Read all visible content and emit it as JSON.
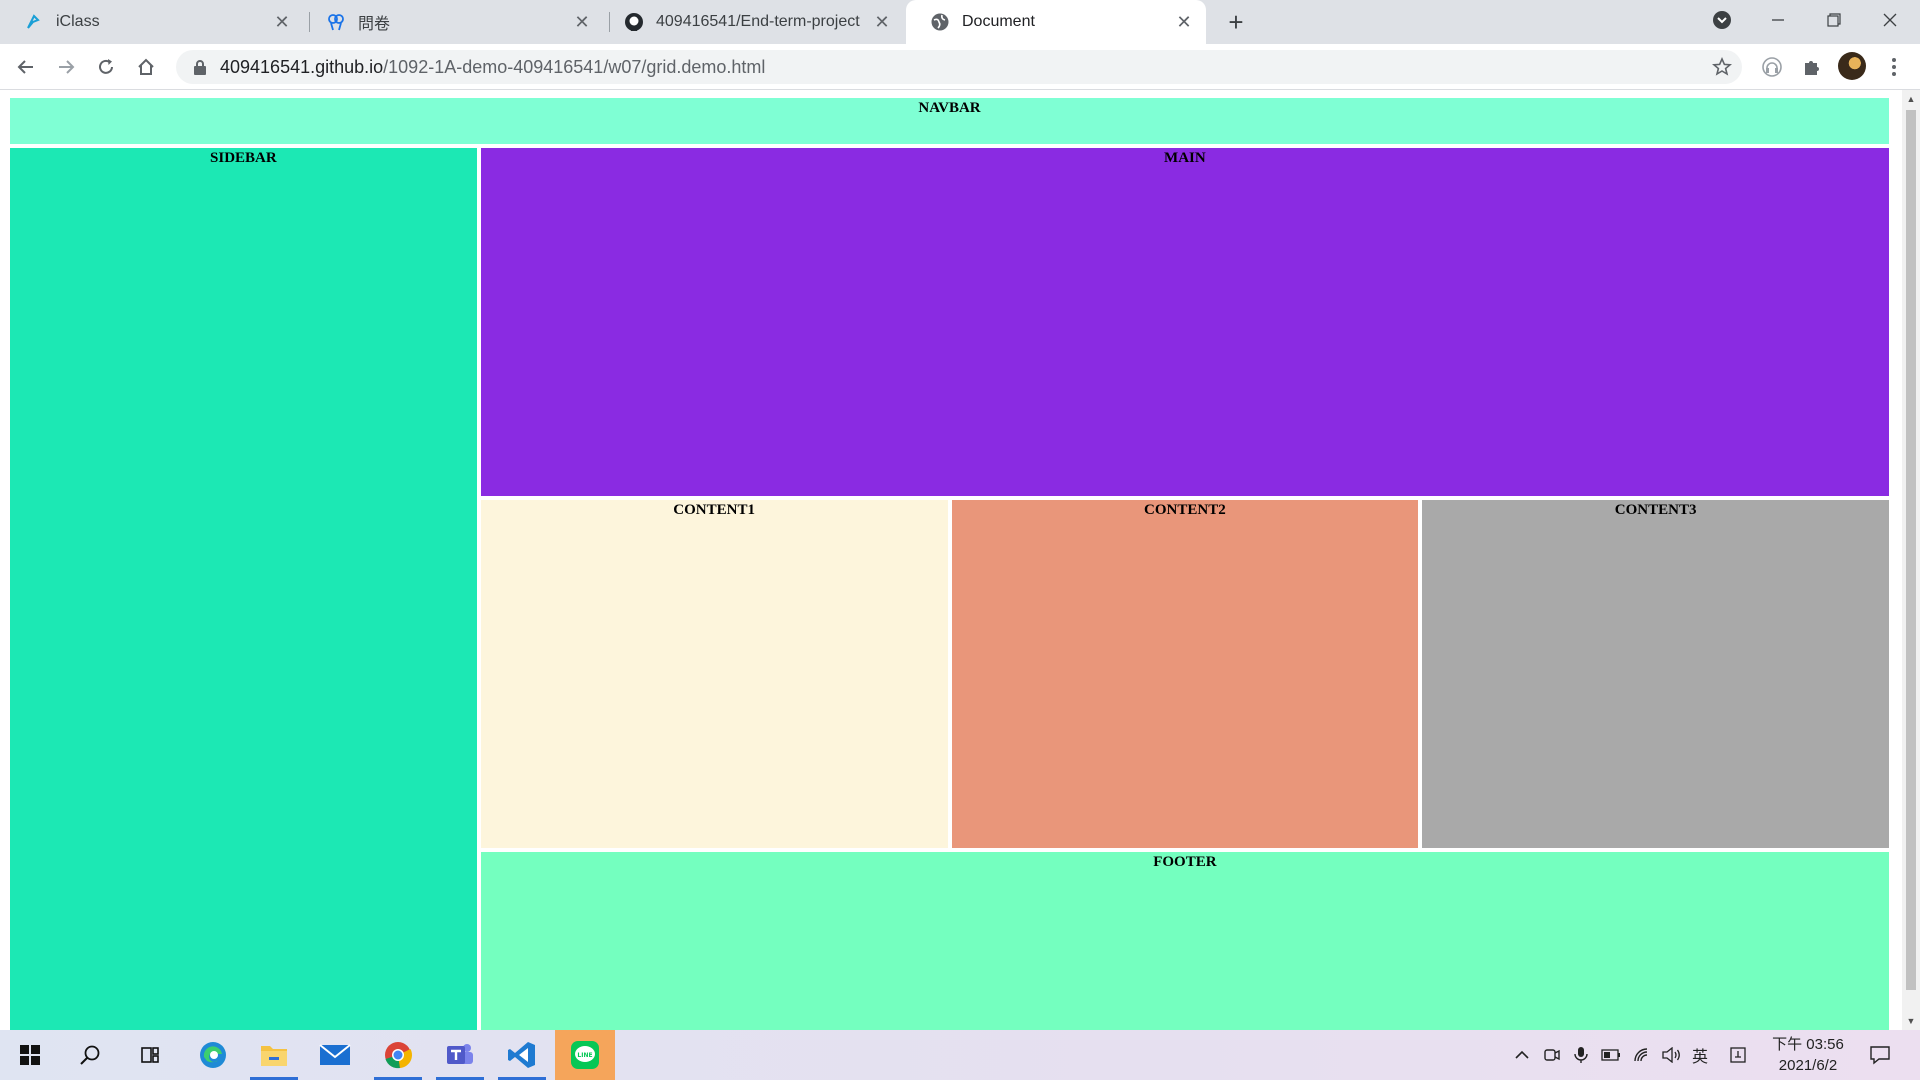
{
  "browser": {
    "tabs": [
      {
        "title": "iClass",
        "icon": "iclass-icon"
      },
      {
        "title": "問卷",
        "icon": "survey-icon"
      },
      {
        "title": "409416541/End-term-project",
        "icon": "github-icon"
      },
      {
        "title": "Document",
        "icon": "globe-icon"
      }
    ],
    "close_glyph": "✕",
    "new_tab_glyph": "+",
    "url_host": "409416541.github.io",
    "url_path": "/1092-1A-demo-409416541/w07/grid.demo.html"
  },
  "page": {
    "navbar_label": "NAVBAR",
    "sidebar_label": "SIDEBAR",
    "main_label": "MAIN",
    "content1_label": "CONTENT1",
    "content2_label": "CONTENT2",
    "content3_label": "CONTENT3",
    "footer_label": "FOOTER"
  },
  "colors": {
    "navbar": "#7fffd4",
    "sidebar": "#1ce8b4",
    "main": "#8a2be2",
    "content1": "#fdf5dc",
    "content2": "#e9967a",
    "content3": "#a9a9a9",
    "footer": "#74ffbf"
  },
  "taskbar": {
    "apps": [
      "windows-start-icon",
      "search-icon",
      "task-view-icon",
      "edge-icon",
      "file-explorer-icon",
      "mail-icon",
      "chrome-icon",
      "teams-icon",
      "vscode-icon",
      "line-icon"
    ],
    "ime_label": "英",
    "time": "下午 03:56",
    "date": "2021/6/2"
  }
}
